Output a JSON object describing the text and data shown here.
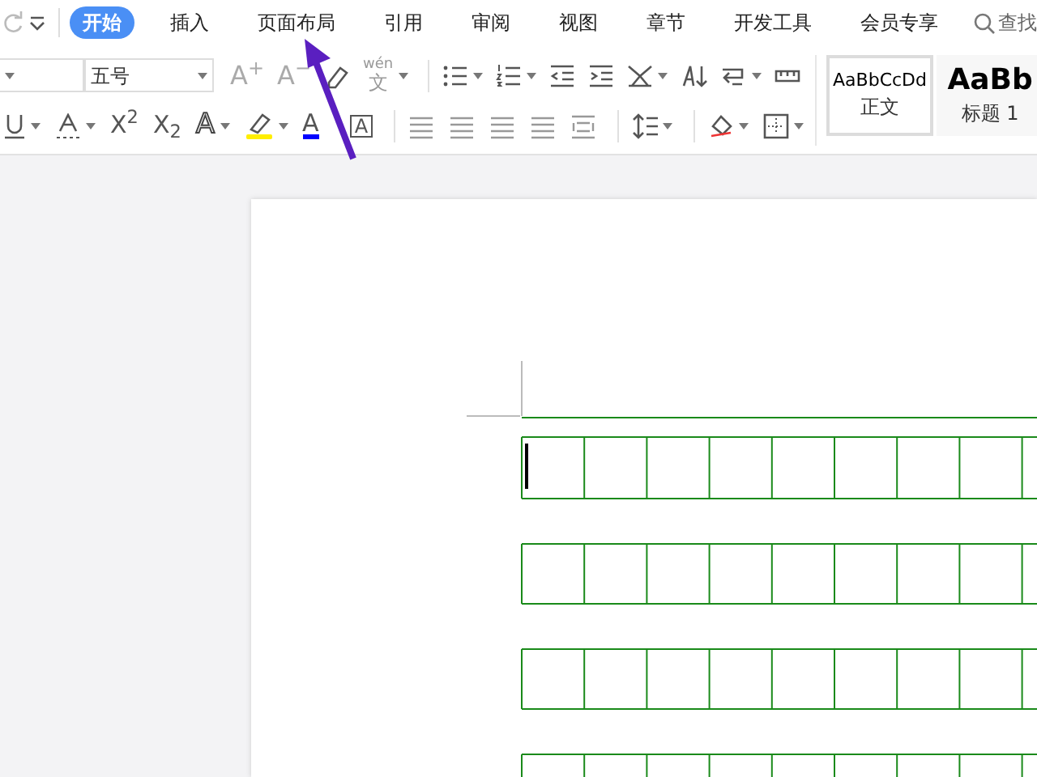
{
  "quick_access": [
    {
      "kind": "redo",
      "disabled": true
    },
    {
      "kind": "customize"
    }
  ],
  "tabs": [
    {
      "label": "开始",
      "selected": true
    },
    {
      "label": "插入",
      "selected": false
    },
    {
      "label": "页面布局",
      "selected": false
    },
    {
      "label": "引用",
      "selected": false
    },
    {
      "label": "审阅",
      "selected": false
    },
    {
      "label": "视图",
      "selected": false
    },
    {
      "label": "章节",
      "selected": false
    },
    {
      "label": "开发工具",
      "selected": false
    },
    {
      "label": "会员专享",
      "selected": false
    }
  ],
  "search": {
    "label": "查找"
  },
  "font_size": {
    "value": "五号"
  },
  "toolbar_row_1": [
    {
      "kind": "grow",
      "text": "A$^{+}$"
    },
    {
      "kind": "shrink",
      "text": "A$^{−}$"
    },
    {
      "kind": "clear"
    },
    {
      "kind": "phonetic",
      "ruby": "wén",
      "base": "文",
      "caret": true
    },
    {
      "kind": "sep"
    },
    {
      "kind": "bullets",
      "caret": true
    },
    {
      "kind": "numbering",
      "caret": true
    },
    {
      "kind": "outdent"
    },
    {
      "kind": "indent"
    },
    {
      "kind": "layout",
      "caret": true
    },
    {
      "kind": "sort"
    },
    {
      "kind": "wrap",
      "caret": true
    },
    {
      "kind": "ruler"
    }
  ],
  "toolbar_row_2": [
    {
      "kind": "underline",
      "caret": true
    },
    {
      "kind": "emphasis",
      "caret": true
    },
    {
      "kind": "text",
      "text": "X$^{2}$"
    },
    {
      "kind": "text",
      "text": "X$_{2}$"
    },
    {
      "kind": "effect",
      "text": "A",
      "caret": true
    },
    {
      "kind": "highlight",
      "color": "#ffee00",
      "caret": true
    },
    {
      "kind": "fontcolor",
      "text": "A",
      "color": "#0000ff"
    },
    {
      "kind": "border",
      "text": "A"
    },
    {
      "kind": "sep"
    },
    {
      "kind": "align"
    },
    {
      "kind": "align"
    },
    {
      "kind": "align"
    },
    {
      "kind": "align"
    },
    {
      "kind": "distribute"
    },
    {
      "kind": "sep"
    },
    {
      "kind": "spacing",
      "caret": true
    },
    {
      "kind": "sep"
    },
    {
      "kind": "shading",
      "caret": true
    },
    {
      "kind": "borders",
      "caret": true
    }
  ],
  "styles": [
    {
      "preview": "AaBbCcDd",
      "name": "正文",
      "selected": true
    },
    {
      "preview": "AaBb",
      "name": "标题 1",
      "selected": false
    }
  ]
}
